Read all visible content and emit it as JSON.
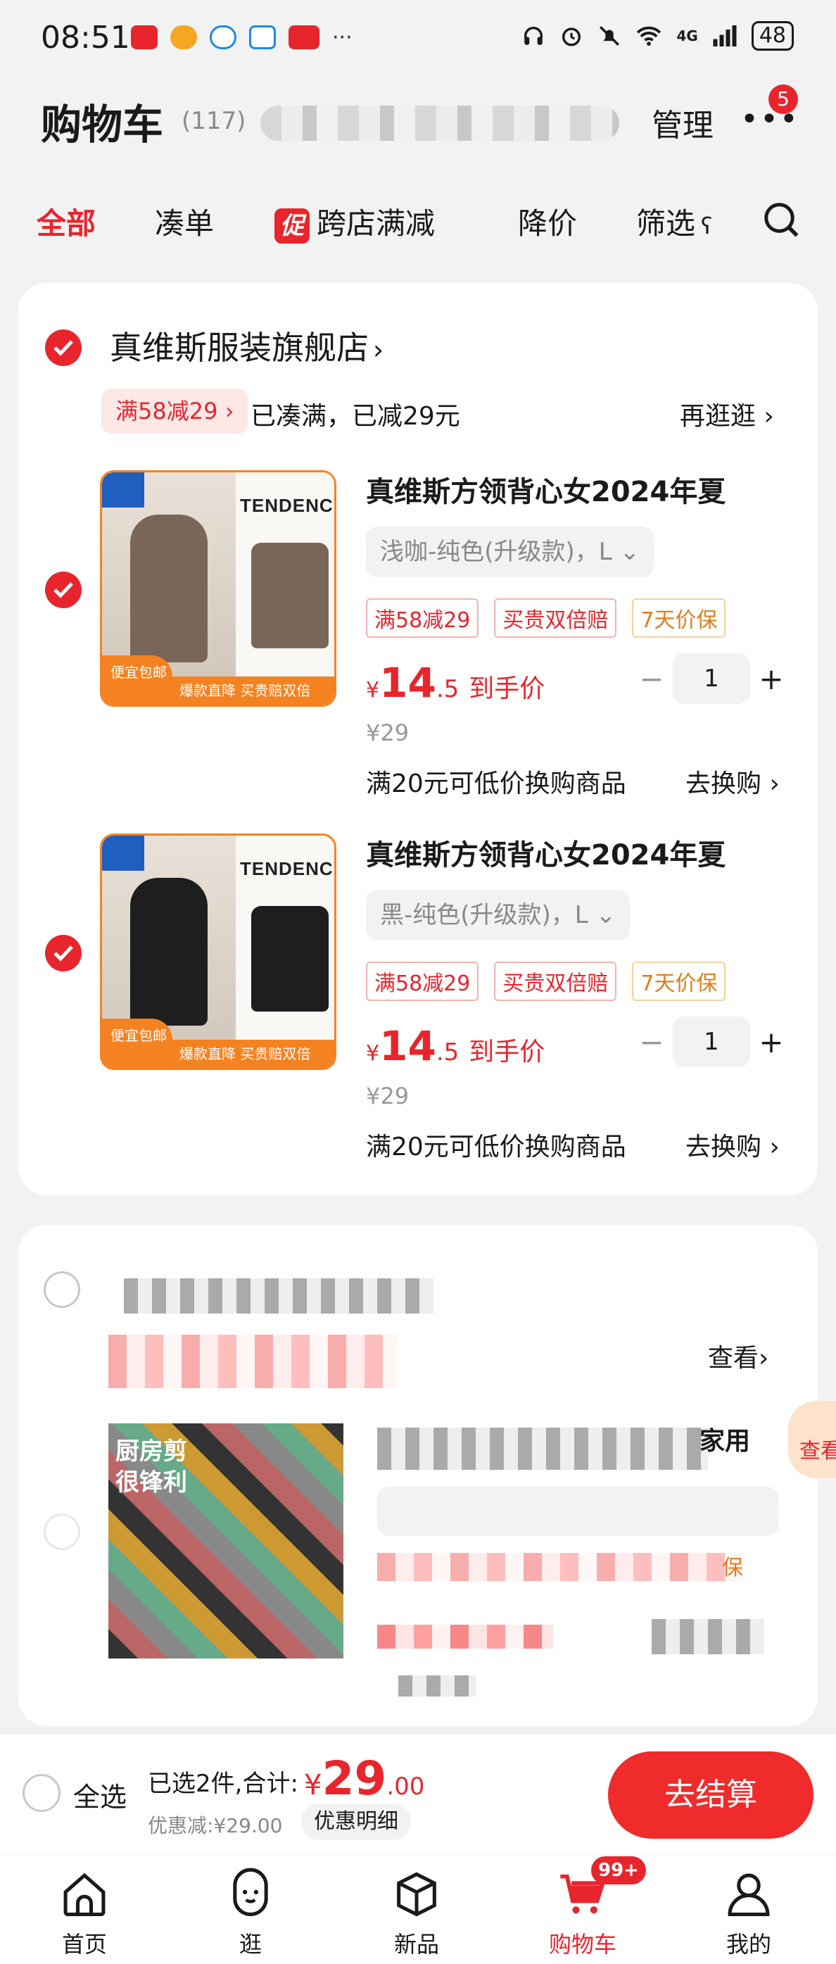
{
  "status": {
    "time": "08:51",
    "network": "4G",
    "battery": "48"
  },
  "header": {
    "title": "购物车",
    "count": "(117)",
    "manage": "管理",
    "more_badge": "5"
  },
  "tabs": [
    {
      "label": "全部",
      "active": true
    },
    {
      "label": "凑单"
    },
    {
      "label": "跨店满减",
      "chip": "促"
    },
    {
      "label": "降价"
    },
    {
      "label": "筛选"
    }
  ],
  "store1": {
    "name": "真维斯服装旗舰店",
    "promo_tag": "满58减29",
    "promo_text": "已凑满，已减29元",
    "browse": "再逛逛"
  },
  "products": [
    {
      "title": "真维斯方领背心女2024年夏",
      "sku": "浅咖-纯色(升级款)，L",
      "tags": [
        "满58减29",
        "买贵双倍赔",
        "7天价保"
      ],
      "price_yen": "¥",
      "price_int": "14",
      "price_dec": ".5",
      "price_label": "到手价",
      "orig_price": "¥29",
      "qty": "1",
      "swap_text": "满20元可低价换购商品",
      "swap_link": "去换购",
      "thumb_brand": "TENDENCY",
      "thumb_footer": "爆款直降  买贵赔双倍",
      "thumb_corner": "便宜包邮",
      "tank_color": "#7a6658"
    },
    {
      "title": "真维斯方领背心女2024年夏",
      "sku": "黑-纯色(升级款)，L",
      "tags": [
        "满58减29",
        "买贵双倍赔",
        "7天价保"
      ],
      "price_yen": "¥",
      "price_int": "14",
      "price_dec": ".5",
      "price_label": "到手价",
      "orig_price": "¥29",
      "qty": "1",
      "swap_text": "满20元可低价换购商品",
      "swap_link": "去换购",
      "thumb_brand": "TENDENCY",
      "thumb_footer": "爆款直降  买贵赔双倍",
      "thumb_corner": "便宜包邮",
      "tank_color": "#1e1e1e"
    }
  ],
  "store2": {
    "browse_partial": "查看",
    "title_partial": "家用",
    "thumb_text": "厨房剪很锋利",
    "tag_partial": "保",
    "peek_label": "查看"
  },
  "bottom": {
    "select_all": "全选",
    "summary": "已选2件,合计:",
    "total_yen": "¥",
    "total_int": "29",
    "total_dec": ".00",
    "discount": "优惠减:¥29.00",
    "detail": "优惠明细",
    "checkout": "去结算"
  },
  "nav": [
    {
      "label": "首页",
      "icon": "home-icon"
    },
    {
      "label": "逛",
      "icon": "explore-icon"
    },
    {
      "label": "新品",
      "icon": "box-icon"
    },
    {
      "label": "购物车",
      "icon": "cart-icon",
      "active": true,
      "badge": "99+"
    },
    {
      "label": "我的",
      "icon": "user-icon"
    }
  ],
  "colors": {
    "accent": "#e8252c",
    "background": "#f2f2f2"
  }
}
